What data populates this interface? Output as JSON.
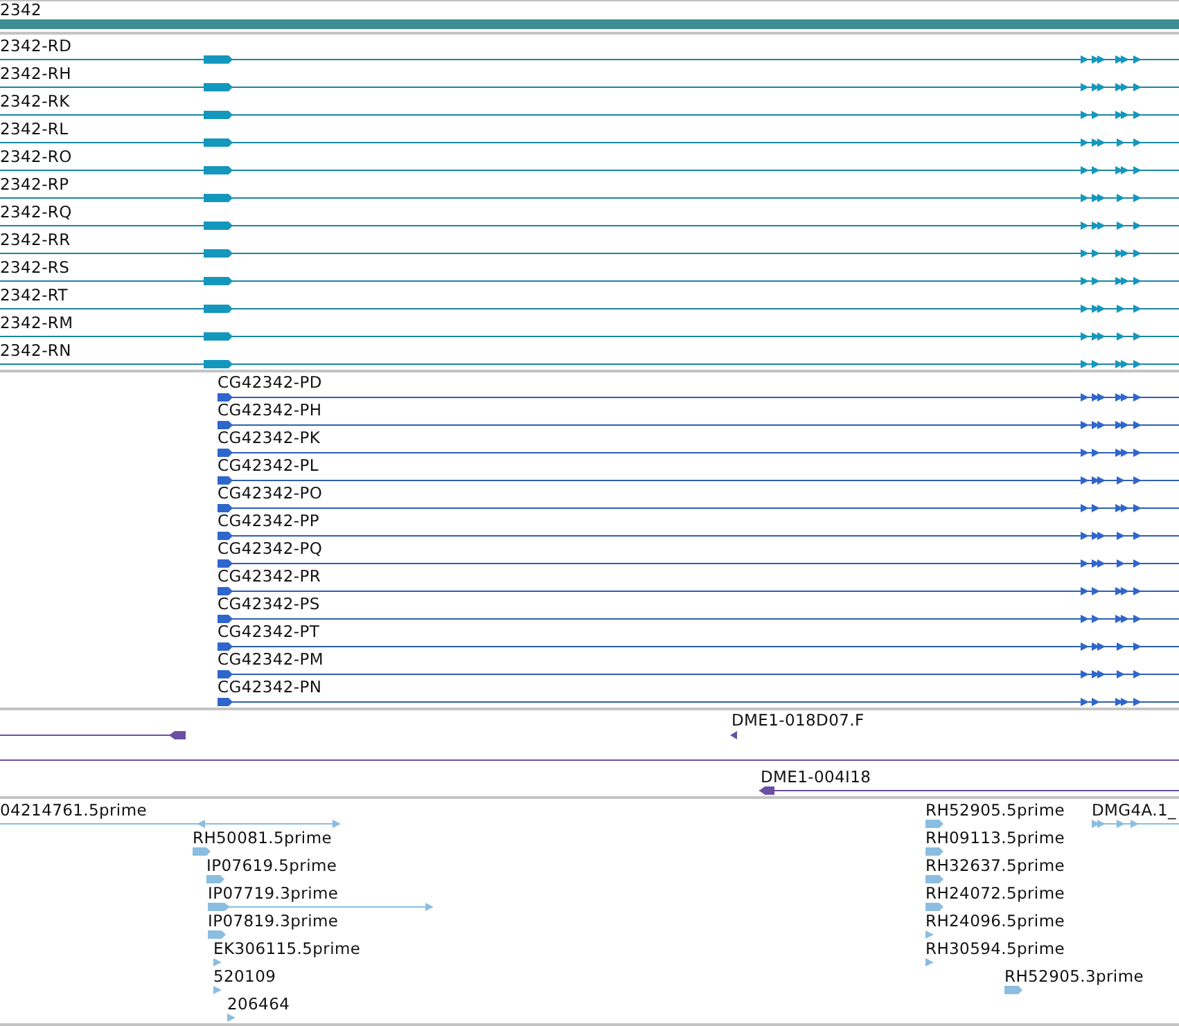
{
  "tracks": [
    {
      "kind": "gene",
      "label": "2342"
    },
    {
      "kind": "transcripts",
      "rows": [
        {
          "label": "2342-RD"
        },
        {
          "label": "2342-RH"
        },
        {
          "label": "2342-RK"
        },
        {
          "label": "2342-RL"
        },
        {
          "label": "2342-RO"
        },
        {
          "label": "2342-RP"
        },
        {
          "label": "2342-RQ"
        },
        {
          "label": "2342-RR"
        },
        {
          "label": "2342-RS"
        },
        {
          "label": "2342-RT"
        },
        {
          "label": "2342-RM"
        },
        {
          "label": "2342-RN"
        }
      ]
    },
    {
      "kind": "proteins",
      "rows": [
        {
          "label": "CG42342-PD"
        },
        {
          "label": "CG42342-PH"
        },
        {
          "label": "CG42342-PK"
        },
        {
          "label": "CG42342-PL"
        },
        {
          "label": "CG42342-PO"
        },
        {
          "label": "CG42342-PP"
        },
        {
          "label": "CG42342-PQ"
        },
        {
          "label": "CG42342-PR"
        },
        {
          "label": "CG42342-PS"
        },
        {
          "label": "CG42342-PT"
        },
        {
          "label": "CG42342-PM"
        },
        {
          "label": "CG42342-PN"
        }
      ]
    },
    {
      "kind": "clones",
      "features": [
        {
          "label": "DME1-018D07.F"
        },
        {
          "label": "DME1-004I18"
        }
      ]
    },
    {
      "kind": "ests",
      "features": [
        {
          "label": "04214761.5prime"
        },
        {
          "label": "RH52905.5prime"
        },
        {
          "label": "DMG4A.1_"
        },
        {
          "label": "RH50081.5prime"
        },
        {
          "label": "RH09113.5prime"
        },
        {
          "label": "IP07619.5prime"
        },
        {
          "label": "RH32637.5prime"
        },
        {
          "label": "IP07719.3prime"
        },
        {
          "label": "RH24072.5prime"
        },
        {
          "label": "IP07819.3prime"
        },
        {
          "label": "RH24096.5prime"
        },
        {
          "label": "EK306115.5prime"
        },
        {
          "label": "RH30594.5prime"
        },
        {
          "label": "520109"
        },
        {
          "label": "RH52905.3prime"
        },
        {
          "label": "206464"
        }
      ]
    }
  ]
}
